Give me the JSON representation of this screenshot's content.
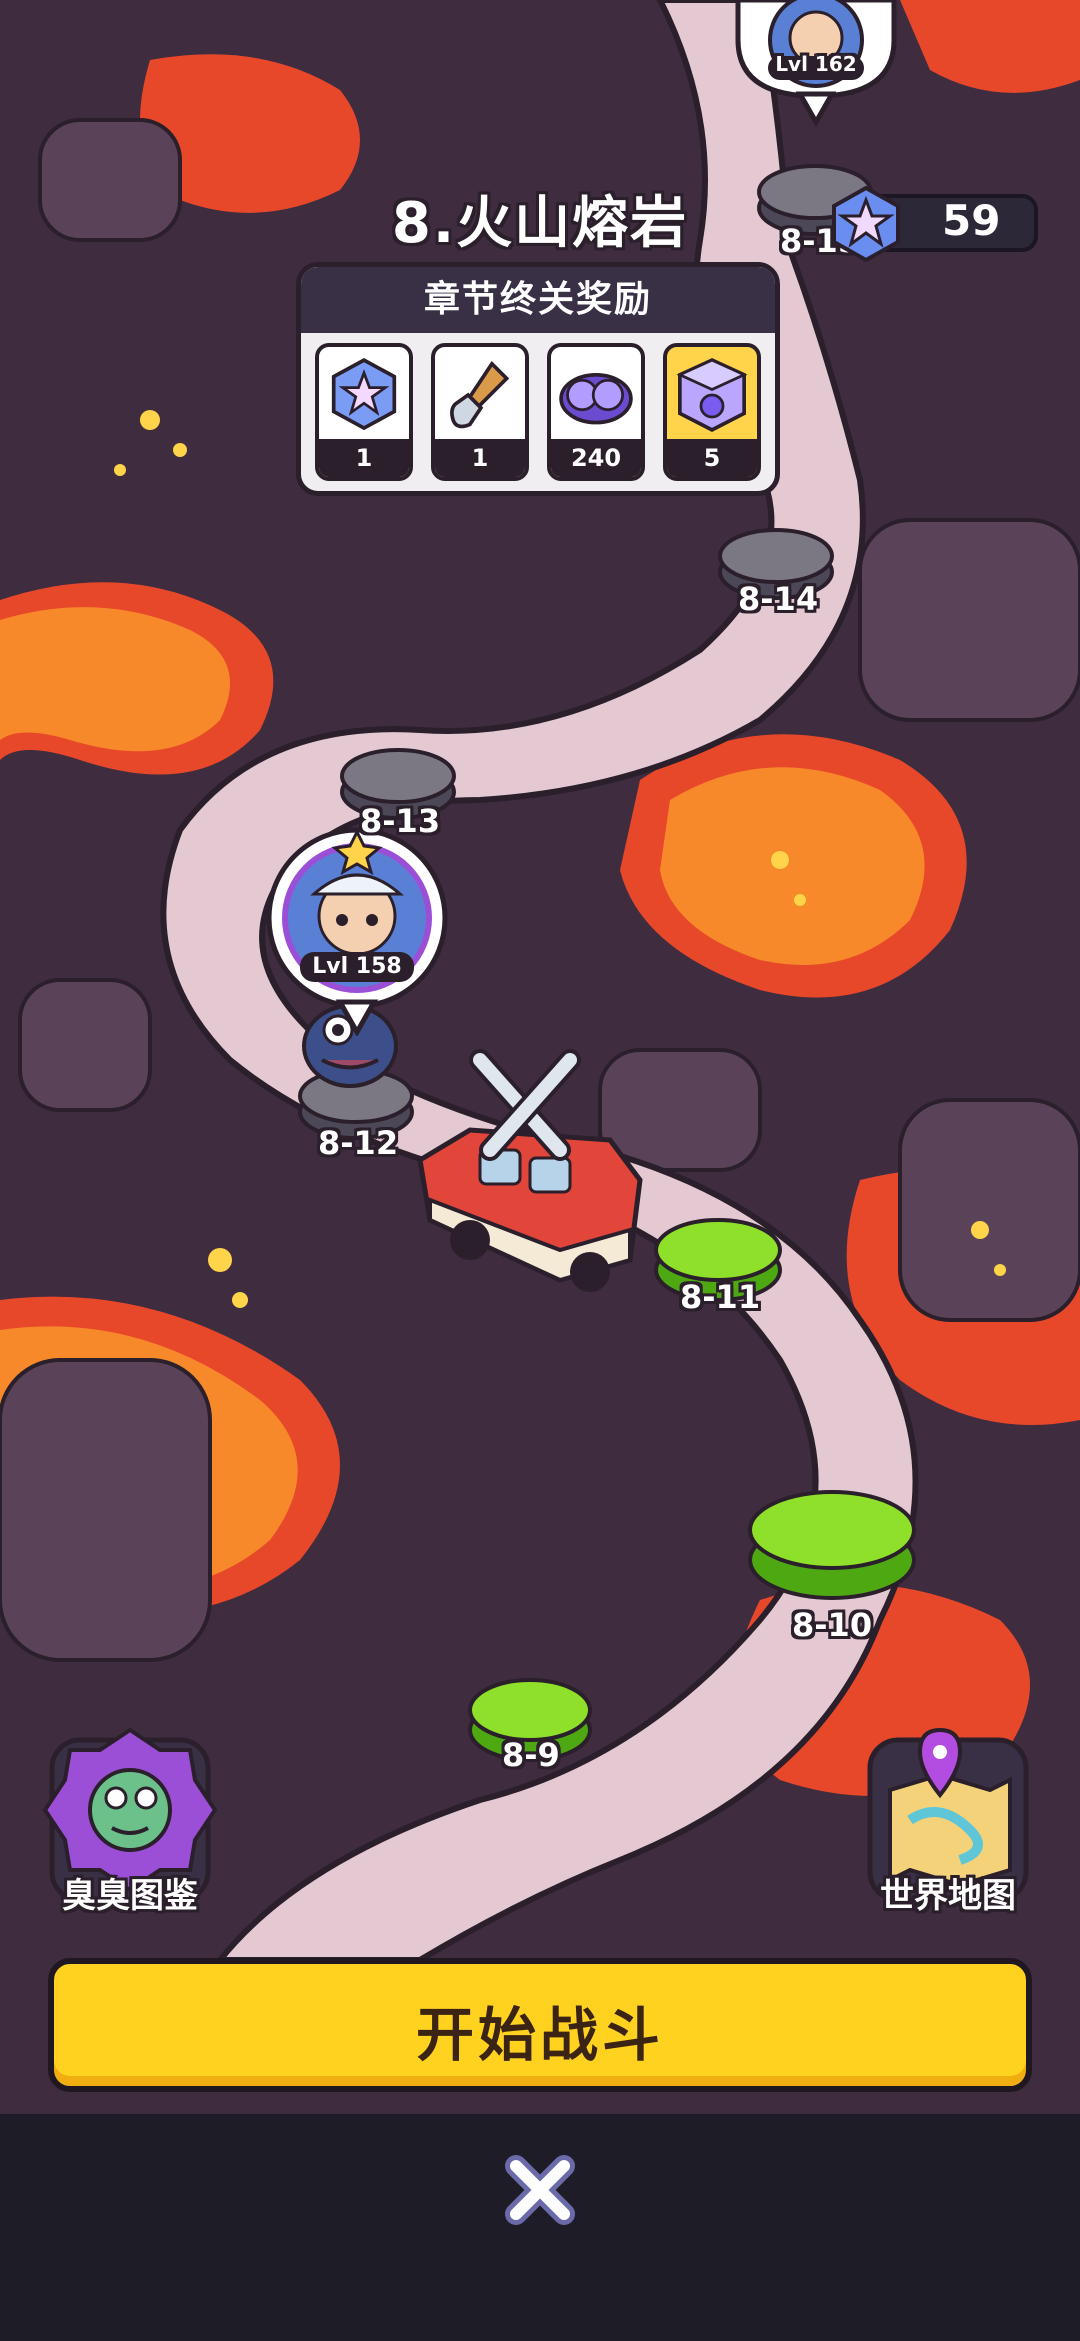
{
  "chapter": {
    "title": "8.火山熔岩"
  },
  "currency": {
    "value": "59",
    "icon": "star-badge-icon"
  },
  "rewards": {
    "header": "章节终关奖励",
    "items": [
      {
        "icon": "star-badge-icon",
        "count": "1"
      },
      {
        "icon": "shovel-icon",
        "count": "1"
      },
      {
        "icon": "purple-orbs-icon",
        "count": "240"
      },
      {
        "icon": "mystery-box-icon",
        "count": "5"
      }
    ]
  },
  "nodes": [
    {
      "label": "8-15",
      "state": "locked"
    },
    {
      "label": "8-14",
      "state": "locked"
    },
    {
      "label": "8-13",
      "state": "locked"
    },
    {
      "label": "8-12",
      "state": "current"
    },
    {
      "label": "8-11",
      "state": "cleared"
    },
    {
      "label": "8-10",
      "state": "cleared"
    },
    {
      "label": "8-9",
      "state": "cleared"
    }
  ],
  "players": [
    {
      "level": "Lvl 162"
    },
    {
      "level": "Lvl 158"
    }
  ],
  "buttons": {
    "zombie_guide": "臭臭图鉴",
    "world_map": "世界地图",
    "start_battle": "开始战斗"
  },
  "colors": {
    "lava": "#f0642a",
    "path": "#e5c9d2",
    "cleared_node": "#8ee02a",
    "locked_node": "#7b7883",
    "start_button": "#ffd21f"
  }
}
